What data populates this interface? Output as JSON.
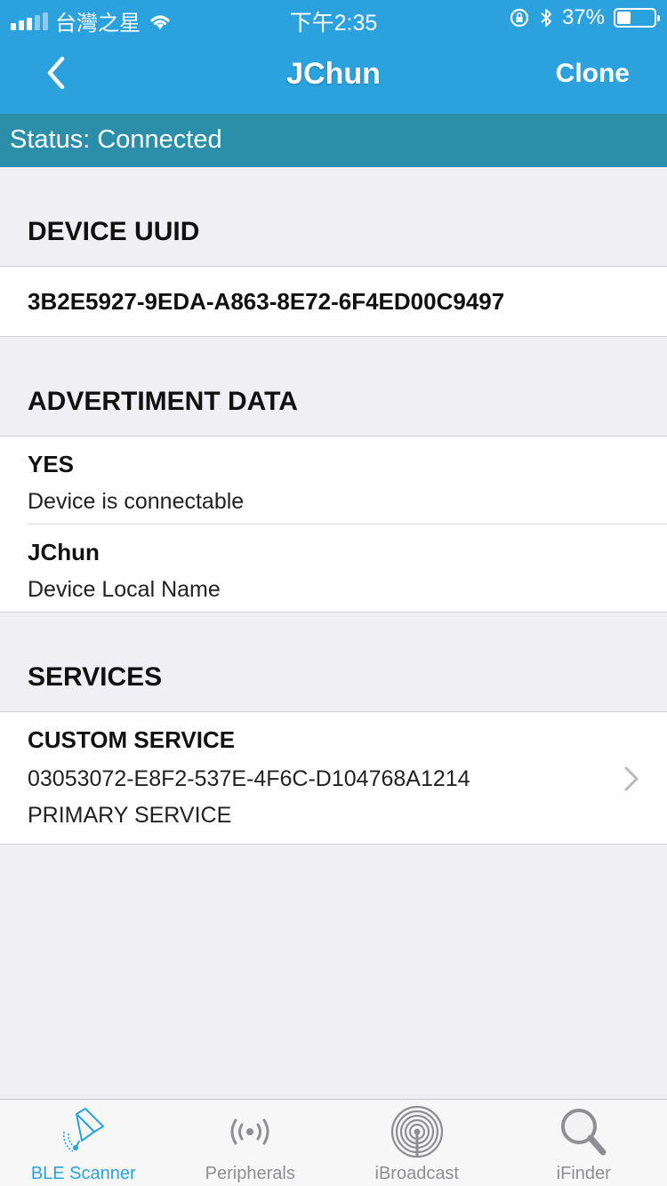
{
  "status_bar": {
    "carrier": "台灣之星",
    "time": "下午2:35",
    "battery": "37%",
    "battery_level": 0.37
  },
  "nav": {
    "title": "JChun",
    "right_action": "Clone"
  },
  "connection_status": "Status: Connected",
  "sections": {
    "device_uuid": {
      "header": "DEVICE UUID",
      "value": "3B2E5927-9EDA-A863-8E72-6F4ED00C9497"
    },
    "advertisement": {
      "header": "ADVERTIMENT DATA",
      "items": [
        {
          "value": "YES",
          "label": "Device is connectable"
        },
        {
          "value": "JChun",
          "label": "Device Local Name"
        }
      ]
    },
    "services": {
      "header": "SERVICES",
      "items": [
        {
          "name": "CUSTOM SERVICE",
          "uuid": "03053072-E8F2-537E-4F6C-D104768A1214",
          "type": "PRIMARY SERVICE"
        }
      ]
    }
  },
  "tabs": [
    {
      "label": "BLE Scanner",
      "icon": "ble-scanner-icon",
      "active": true
    },
    {
      "label": "Peripherals",
      "icon": "peripherals-icon",
      "active": false
    },
    {
      "label": "iBroadcast",
      "icon": "ibroadcast-icon",
      "active": false
    },
    {
      "label": "iFinder",
      "icon": "ifinder-icon",
      "active": false
    }
  ],
  "colors": {
    "nav_blue": "#2ba2dd",
    "status_teal": "#2b8fa9",
    "background": "#efeff4"
  }
}
